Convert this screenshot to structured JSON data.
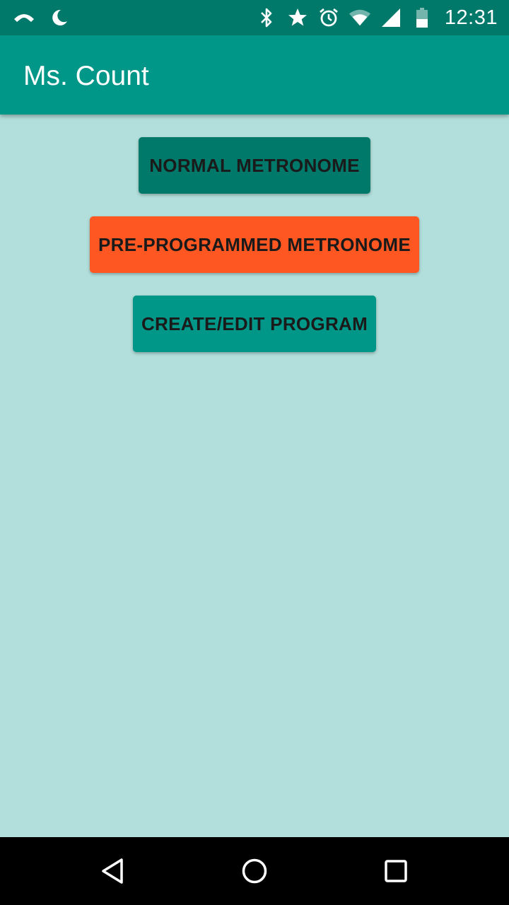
{
  "status_bar": {
    "time": "12:31",
    "left_icons": [
      "phone-icon",
      "moon-icon"
    ],
    "right_icons": [
      "bluetooth-icon",
      "star-icon",
      "alarm-icon",
      "wifi-icon",
      "signal-icon",
      "battery-icon"
    ]
  },
  "app_bar": {
    "title": "Ms. Count"
  },
  "buttons": {
    "normal_metronome": "NORMAL METRONOME",
    "pre_programmed_metronome": "PRE-PROGRAMMED METRONOME",
    "create_edit_program": "CREATE/EDIT PROGRAM"
  },
  "colors": {
    "status_bar": "#00796b",
    "app_bar": "#009688",
    "background": "#b2dfdb",
    "normal_button": "#00796b",
    "pre_programmed_button": "#ff5722",
    "create_button": "#009688",
    "nav_bar": "#000000"
  },
  "nav_bar": {
    "icons": [
      "back-icon",
      "home-icon",
      "recents-icon"
    ]
  }
}
